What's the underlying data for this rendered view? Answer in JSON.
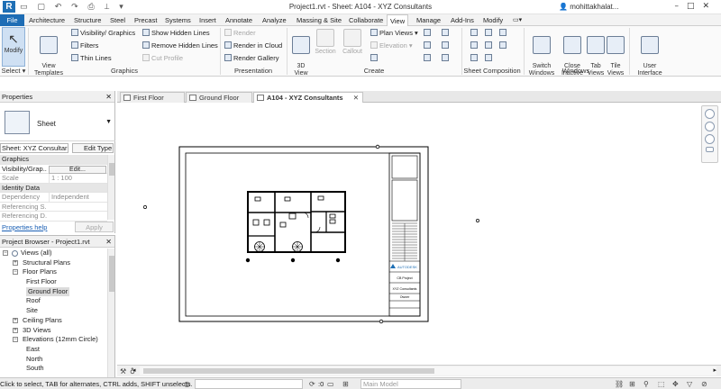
{
  "titlebar": {
    "logo": "R",
    "title": "Project1.rvt - Sheet: A104 - XYZ Consultants",
    "user": "mohittakhalat...",
    "qat_icons": [
      "open-icon",
      "save-icon",
      "undo-icon",
      "redo-icon",
      "print-icon",
      "measure-icon"
    ]
  },
  "menu": {
    "tabs": [
      "File",
      "Architecture",
      "Structure",
      "Steel",
      "Precast",
      "Systems",
      "Insert",
      "Annotate",
      "Analyze",
      "Massing & Site",
      "Collaborate",
      "View",
      "Manage",
      "Add-Ins",
      "Modify"
    ],
    "active": "View"
  },
  "ribbon": {
    "modify_label": "Modify",
    "select_label": "Select ▾",
    "view_templates": "View\nTemplates",
    "graphics": {
      "title": "Graphics",
      "visibility": "Visibility/ Graphics",
      "filters": "Filters",
      "thin_lines": "Thin Lines",
      "show_hidden": "Show  Hidden Lines",
      "remove_hidden": "Remove  Hidden Lines",
      "cut_profile": "Cut  Profile"
    },
    "presentation": {
      "title": "Presentation",
      "render": "Render",
      "render_cloud": "Render  in Cloud",
      "render_gallery": "Render  Gallery"
    },
    "create": {
      "title": "Create",
      "view3d": "3D\nView",
      "section": "Section",
      "callout": "Callout",
      "plan_views": "Plan  Views ▾",
      "elevation": "Elevation ▾"
    },
    "sheet_composition": {
      "title": "Sheet Composition"
    },
    "windows": {
      "title": "Windows",
      "switch": "Switch\nWindows",
      "close_inactive": "Close\nInactive",
      "tab_views": "Tab\nViews",
      "tile_views": "Tile\nViews"
    },
    "ui": {
      "user_interface": "User\nInterface"
    }
  },
  "view_tabs": [
    {
      "label": "First Floor",
      "active": false
    },
    {
      "label": "Ground Floor",
      "active": false
    },
    {
      "label": "A104 - XYZ Consultants",
      "active": true
    }
  ],
  "properties": {
    "title": "Properties",
    "type_name": "Sheet",
    "selector": "Sheet: XYZ Consultar",
    "edit_type": "Edit Type",
    "rows": [
      {
        "group": "Graphics"
      },
      {
        "k": "Visibility/Grap...",
        "btn": "Edit..."
      },
      {
        "k": "Scale",
        "v": "1 : 100",
        "dis": true
      },
      {
        "group": "Identity Data"
      },
      {
        "k": "Dependency",
        "v": "Independent",
        "dis": true
      },
      {
        "k": "Referencing S...",
        "v": "",
        "dis": true
      },
      {
        "k": "Referencing D...",
        "v": "",
        "dis": true
      }
    ],
    "help": "Properties help",
    "apply": "Apply"
  },
  "browser": {
    "title": "Project Browser - Project1.rvt",
    "items": [
      {
        "label": "Views (all)",
        "indent": 0,
        "pm": "−",
        "icon": true
      },
      {
        "label": "Structural Plans",
        "indent": 1,
        "pm": "+"
      },
      {
        "label": "Floor Plans",
        "indent": 1,
        "pm": "−"
      },
      {
        "label": "First Floor",
        "indent": 2
      },
      {
        "label": "Ground Floor",
        "indent": 2,
        "selected": true
      },
      {
        "label": "Roof",
        "indent": 2
      },
      {
        "label": "Site",
        "indent": 2
      },
      {
        "label": "Ceiling Plans",
        "indent": 1,
        "pm": "+"
      },
      {
        "label": "3D Views",
        "indent": 1,
        "pm": "+"
      },
      {
        "label": "Elevations (12mm Circle)",
        "indent": 1,
        "pm": "−"
      },
      {
        "label": "East",
        "indent": 2
      },
      {
        "label": "North",
        "indent": 2
      },
      {
        "label": "South",
        "indent": 2
      }
    ]
  },
  "sheet": {
    "company": "AUTODESK",
    "project": "CB Project",
    "sheet_name": "XYZ Consultants",
    "owner": "Owner"
  },
  "statusbar": {
    "message": "Click to select, TAB for alternates, CTRL adds, SHIFT unselects.",
    "workset_value": ":0",
    "model": "Main Model"
  }
}
